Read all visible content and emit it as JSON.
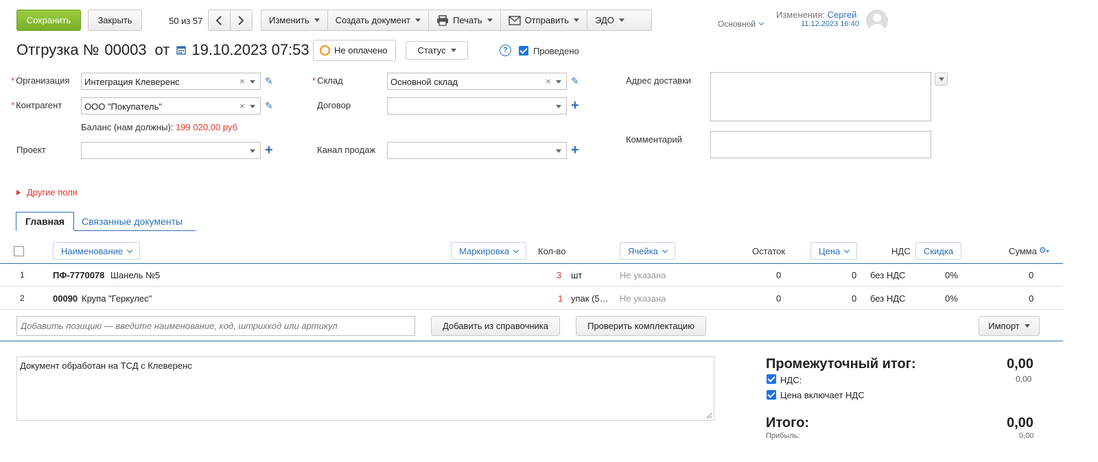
{
  "toolbar": {
    "save_label": "Сохранить",
    "close_label": "Закрыть",
    "pager_text": "50 из 57",
    "edit_label": "Изменить",
    "create_doc_label": "Создать документ",
    "print_label": "Печать",
    "send_label": "Отправить",
    "edo_label": "ЭДО",
    "layout_label": "Основной",
    "changes_label": "Изменения:",
    "changes_user": "Сергей",
    "changes_date": "11.12.2023 16:40"
  },
  "document": {
    "title_prefix": "Отгрузка №",
    "number": "00003",
    "from_label": "от",
    "date": "19.10.2023 07:53",
    "payment_status": "Не оплачено",
    "status_label": "Статус",
    "posted_label": "Проведено",
    "posted": true
  },
  "form": {
    "org_label": "Организация",
    "org_value": "Интеграция Клеверенс",
    "contractor_label": "Контрагент",
    "contractor_value": "ООО \"Покупатель\"",
    "balance_label": "Баланс (нам должны):",
    "balance_value": "199 020,00 руб",
    "project_label": "Проект",
    "project_value": "",
    "warehouse_label": "Склад",
    "warehouse_value": "Основной склад",
    "contract_label": "Договор",
    "contract_value": "",
    "channel_label": "Канал продаж",
    "channel_value": "",
    "address_label": "Адрес доставки",
    "address_value": "",
    "comment_label": "Комментарий",
    "comment_value": "",
    "other_fields_label": "Другие поля"
  },
  "tabs": [
    {
      "label": "Главная",
      "active": true
    },
    {
      "label": "Связанные документы",
      "active": false
    }
  ],
  "table": {
    "headers": {
      "name": "Наименование",
      "marking": "Маркировка",
      "qty": "Кол-во",
      "cell": "Ячейка",
      "stock": "Остаток",
      "price": "Цена",
      "vat": "НДС",
      "discount": "Скидка",
      "sum": "Сумма"
    },
    "rows": [
      {
        "num": "1",
        "code": "ПФ-7770078",
        "name": "Шанель №5",
        "qty": "3",
        "unit": "шт",
        "cell": "Не указана",
        "stock": "0",
        "price": "0",
        "vat": "без НДС",
        "discount": "0%",
        "sum": "0"
      },
      {
        "num": "2",
        "code": "00090",
        "name": "Крупа \"Геркулес\"",
        "qty": "1",
        "unit": "упак (5…",
        "cell": "Не указана",
        "stock": "0",
        "price": "0",
        "vat": "без НДС",
        "discount": "0%",
        "sum": "0"
      }
    ],
    "add_placeholder": "Добавить позицию — введите наименование, код, штрихкод или артикул",
    "add_from_catalog": "Добавить из справочника",
    "check_kit": "Проверить комплектацию",
    "import_label": "Импорт"
  },
  "footer": {
    "note": "Документ обработан на ТСД с Клеверенс",
    "subtotal_label": "Промежуточный итог:",
    "subtotal_value": "0,00",
    "vat_label": "НДС:",
    "vat_value": "0,00",
    "price_incl_vat_label": "Цена включает НДС",
    "total_label": "Итого:",
    "total_value": "0,00",
    "profit_label": "Прибыль:",
    "profit_value": "0,00"
  },
  "colors": {
    "accent_green": "#8cc63f",
    "link_blue": "#2d6fb7",
    "warning_red": "#e0362c",
    "payment_orange": "#f29000"
  }
}
